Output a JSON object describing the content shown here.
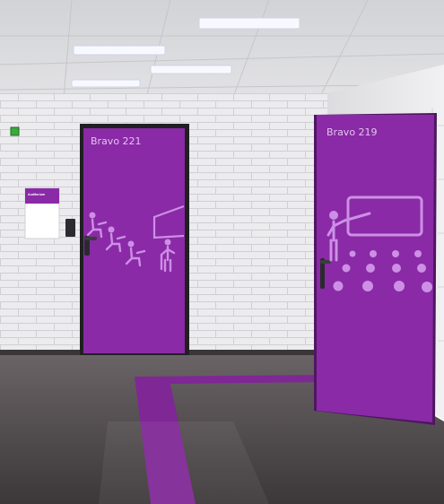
{
  "scene": {
    "door_left": {
      "label": "Bravo 221"
    },
    "door_right": {
      "label": "Bravo 219"
    },
    "wall_sign": {
      "label": "Auditorium"
    }
  },
  "colors": {
    "door_purple": "#8a2aa6",
    "pictogram": "#cd8fe6",
    "floor_stripe": "#7f2795",
    "wall": "#e9e9ec",
    "floor": "#4b4648",
    "exit_light": "#3aaa3a"
  },
  "icons": [
    "ceiling-light-icon",
    "exit-sign-icon",
    "door-handle-icon",
    "card-reader-icon",
    "student-desk-icon",
    "lecturer-icon",
    "audience-icon",
    "board-icon"
  ]
}
